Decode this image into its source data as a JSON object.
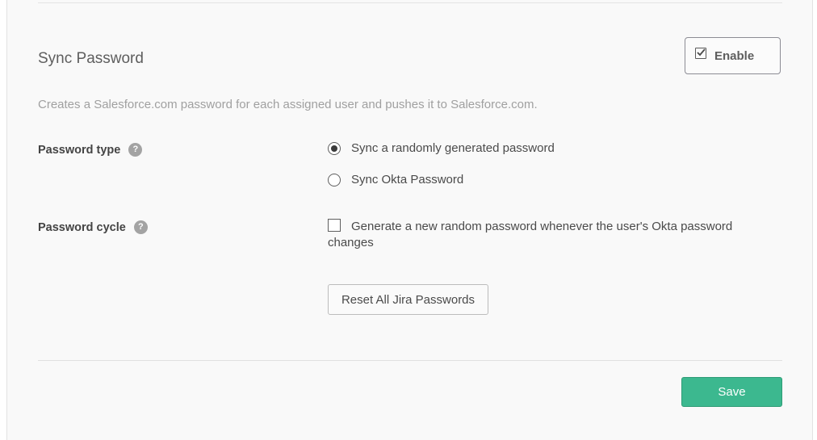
{
  "section": {
    "title": "Sync Password",
    "enable_label": "Enable",
    "enable_checked": true,
    "description": "Creates a Salesforce.com password for each assigned user and pushes it to Salesforce.com."
  },
  "password_type": {
    "label": "Password type",
    "help_icon": "?",
    "options": [
      {
        "label": "Sync a randomly generated password",
        "selected": true
      },
      {
        "label": "Sync Okta Password",
        "selected": false
      }
    ]
  },
  "password_cycle": {
    "label": "Password cycle",
    "help_icon": "?",
    "checkbox_label": "Generate a new random password whenever the user's Okta password changes",
    "checked": false
  },
  "reset_button_label": "Reset All Jira Passwords",
  "save_button_label": "Save",
  "colors": {
    "save_button": "#3cb88f",
    "help_icon": "#a3a3a3",
    "panel_background": "#f9f9f9"
  }
}
